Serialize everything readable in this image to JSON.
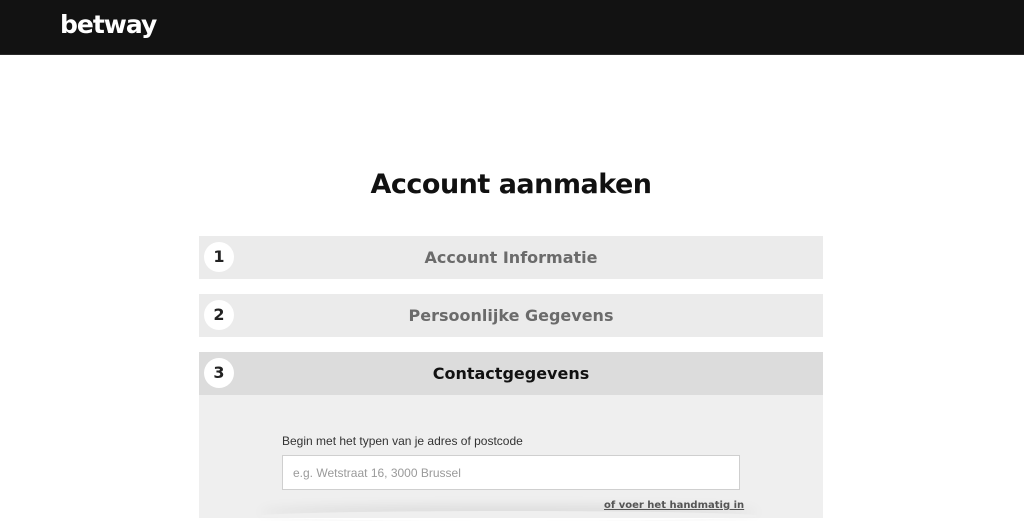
{
  "header": {
    "logo_text": "betway",
    "background": "#121212"
  },
  "main": {
    "title": "Account aanmaken"
  },
  "steps": [
    {
      "number": "1",
      "title": "Account Informatie",
      "state": "collapsed"
    },
    {
      "number": "2",
      "title": "Persoonlijke Gegevens",
      "state": "collapsed"
    },
    {
      "number": "3",
      "title": "Contactgegevens",
      "state": "active"
    }
  ],
  "contact_form": {
    "address_label": "Begin met het typen van je adres of postcode",
    "address_placeholder": "e.g. Wetstraat 16, 3000 Brussel",
    "address_value": "",
    "manual_link": "of voer het handmatig in"
  }
}
